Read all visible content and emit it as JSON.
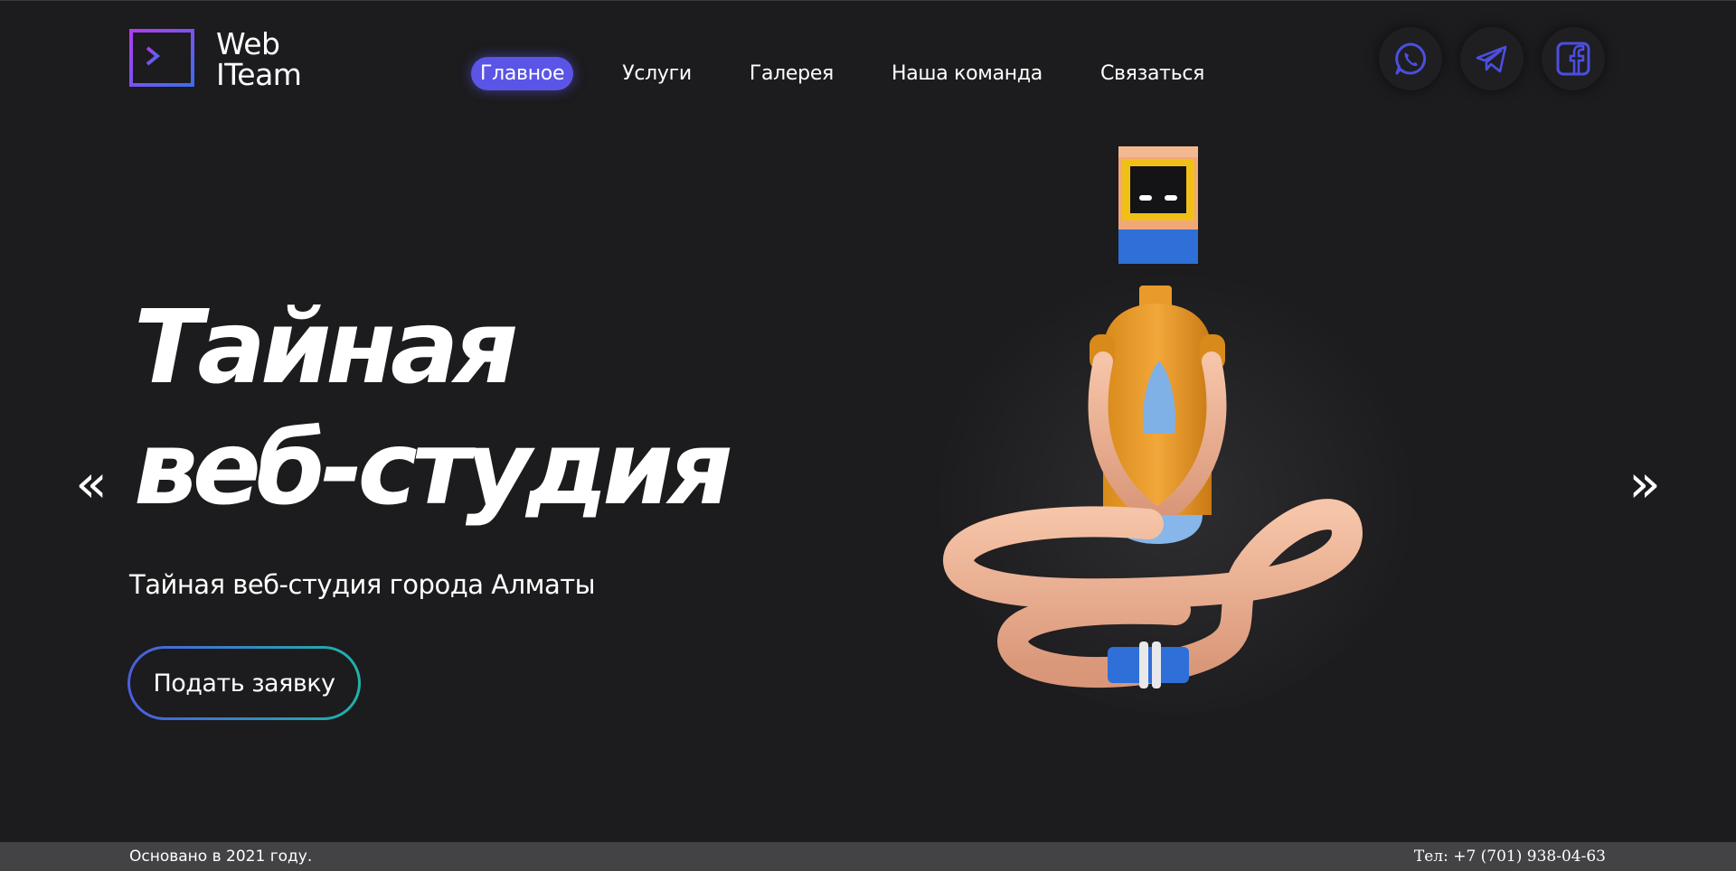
{
  "brand": {
    "line1": "Web",
    "line2": "ITeam",
    "accent": "#5a55e6",
    "gradient_from": "#4a5ee0",
    "gradient_to": "#1fb3a8"
  },
  "nav": {
    "items": [
      {
        "label": "Главное",
        "active": true
      },
      {
        "label": "Услуги",
        "active": false
      },
      {
        "label": "Галерея",
        "active": false
      },
      {
        "label": "Наша команда",
        "active": false
      },
      {
        "label": "Связаться",
        "active": false
      }
    ]
  },
  "socials": [
    {
      "icon": "whatsapp-icon"
    },
    {
      "icon": "telegram-icon"
    },
    {
      "icon": "facebook-icon"
    }
  ],
  "hero": {
    "title_line1": "Тайная",
    "title_line2": "веб-студия",
    "subtitle": "Тайная веб-студия города Алматы",
    "cta_label": "Подать заявку",
    "prev_label": "«",
    "next_label": "»",
    "illustration": "meditating-robot-figure"
  },
  "footer": {
    "founded": "Основано в 2021 году.",
    "phone": "Тел: +7 (701) 938-04-63"
  }
}
